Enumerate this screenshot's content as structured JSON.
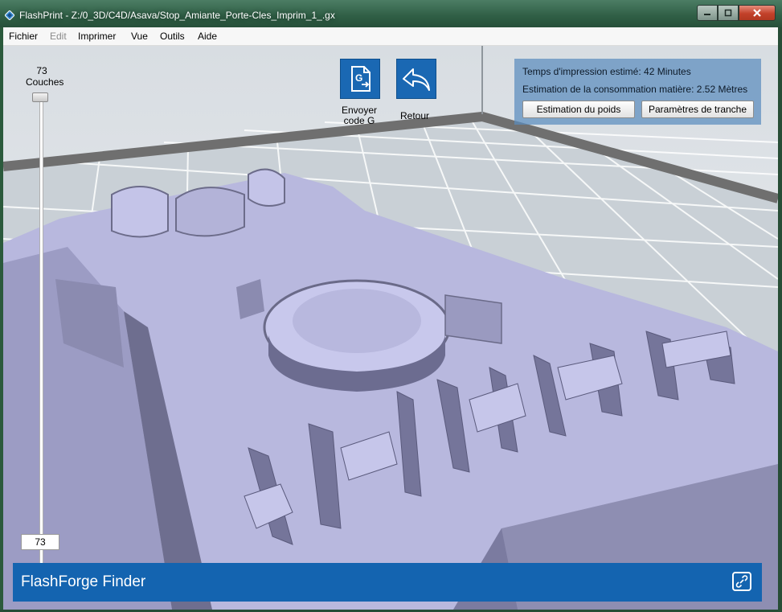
{
  "window": {
    "title": "FlashPrint - Z:/0_3D/C4D/Asava/Stop_Amiante_Porte-Cles_Imprim_1_.gx",
    "app_icon": "flashprint-diamond-icon",
    "controls": {
      "minimize": "minimize-icon",
      "maximize": "maximize-icon",
      "close": "close-icon"
    }
  },
  "menu": [
    "Fichier",
    "Edit",
    "Imprimer",
    "Vue",
    "Outils",
    "Aide"
  ],
  "layers": {
    "count_label": "73",
    "unit": "Couches",
    "current_value": "73"
  },
  "toolbar": {
    "send_gcode": {
      "label_line1": "Envoyer",
      "label_line2": "code G",
      "icon": "gcode-file-icon"
    },
    "back": {
      "label": "Retour",
      "icon": "back-arrow-icon"
    }
  },
  "info": {
    "time_label": "Temps d'impression estimé:",
    "time_value": "42 Minutes",
    "material_label": "Estimation de la consommation matière:",
    "material_value": "2.52 Mètres",
    "weight_button": "Estimation du poids",
    "slice_button": "Paramètres de tranche"
  },
  "status": {
    "printer": "FlashForge Finder",
    "icon": "link-icon"
  },
  "colors": {
    "accent_blue": "#1464b0",
    "model_color": "#b8b8de",
    "platform_color": "#c9d0d6",
    "platform_border": "#6f6f6f",
    "info_panel": "#5a8cbe"
  }
}
